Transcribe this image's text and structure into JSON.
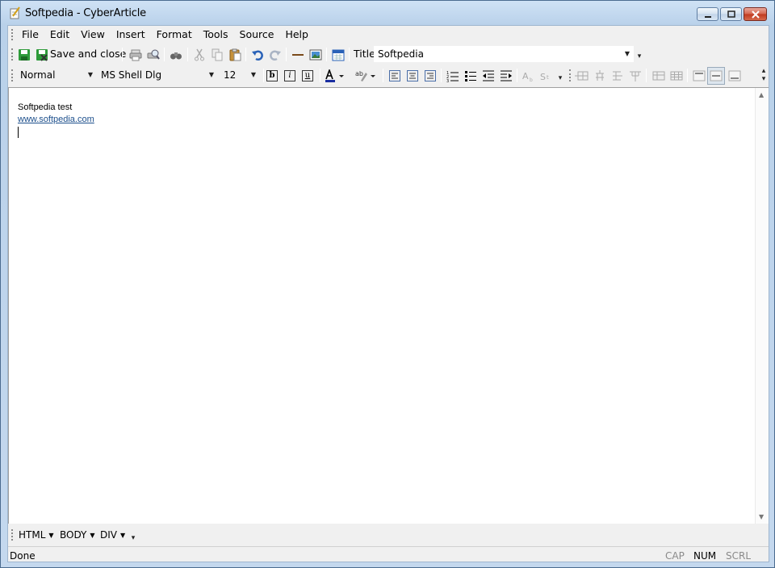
{
  "window": {
    "title": "Softpedia - CyberArticle"
  },
  "menu": [
    "File",
    "Edit",
    "View",
    "Insert",
    "Format",
    "Tools",
    "Source",
    "Help"
  ],
  "toolbar": {
    "save_close_label": "Save and close",
    "title_label": "Title",
    "title_value": "Softpedia"
  },
  "format_bar": {
    "style": "Normal",
    "font": "MS Shell Dlg",
    "size": "12",
    "bold": "b",
    "italic": "i",
    "underline": "u"
  },
  "editor": {
    "line1": "Softpedia test",
    "link": "www.softpedia.com"
  },
  "tags": [
    "HTML",
    "BODY",
    "DIV"
  ],
  "status": {
    "text": "Done",
    "cap": "CAP",
    "num": "NUM",
    "scrl": "SCRL"
  },
  "colors": {
    "titlebar": "#c4d8ee",
    "link": "#1c4f8c",
    "close_button": "#c0391f"
  }
}
